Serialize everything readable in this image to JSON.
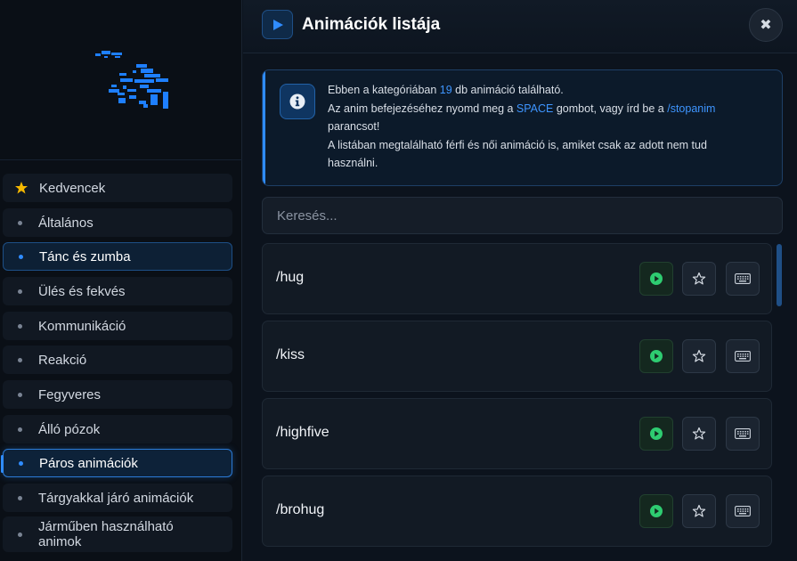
{
  "sidebar": {
    "items": [
      {
        "label": "Kedvencek",
        "icon": "star-icon"
      },
      {
        "label": "Általános"
      },
      {
        "label": "Tánc és zumba"
      },
      {
        "label": "Ülés és fekvés"
      },
      {
        "label": "Kommunikáció"
      },
      {
        "label": "Reakció"
      },
      {
        "label": "Fegyveres"
      },
      {
        "label": "Álló pózok"
      },
      {
        "label": "Páros animációk"
      },
      {
        "label": "Tárgyakkal járó animációk"
      },
      {
        "label": "Járműben használható animok"
      }
    ],
    "active_index": 8
  },
  "header": {
    "title": "Animációk listája",
    "close_symbol": "✖"
  },
  "info": {
    "line1_pre": "Ebben a kategóriában ",
    "count": "19",
    "line1_post": " db animáció található.",
    "line2_pre": "Az anim befejezéséhez nyomd meg a ",
    "key": "SPACE",
    "line2_mid": " gombot, vagy írd be a ",
    "command": "/stopanim",
    "line2_post": " parancsot!",
    "line3": "A listában megtalálható férfi és női animáció is, amiket csak az adott nem tud használni."
  },
  "search": {
    "placeholder": "Keresés..."
  },
  "animations": [
    {
      "name": "/hug"
    },
    {
      "name": "/kiss"
    },
    {
      "name": "/highfive"
    },
    {
      "name": "/brohug"
    }
  ],
  "colors": {
    "accent": "#2f8cff",
    "play": "#2ecc71",
    "star": "#f5b800"
  }
}
